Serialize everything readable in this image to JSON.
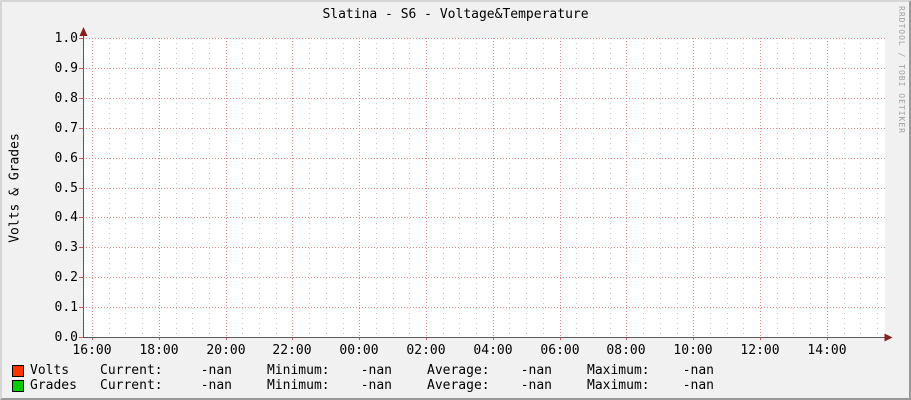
{
  "watermark": "RRDTOOL / TOBI OETIKER",
  "chart_data": {
    "type": "line",
    "title": "Slatina - S6 - Voltage&Temperature",
    "xlabel": "",
    "ylabel": "Volts & Grades",
    "ylim": [
      0.0,
      1.0
    ],
    "y_tick_step": 0.1,
    "y_ticks": [
      "0.0",
      "0.1",
      "0.2",
      "0.3",
      "0.4",
      "0.5",
      "0.6",
      "0.7",
      "0.8",
      "0.9",
      "1.0"
    ],
    "x_ticks": [
      "16:00",
      "18:00",
      "20:00",
      "22:00",
      "00:00",
      "02:00",
      "04:00",
      "06:00",
      "08:00",
      "10:00",
      "12:00",
      "14:00"
    ],
    "x_minor_divisions": 4,
    "grid": true,
    "legend_position": "bottom",
    "series": [
      {
        "name": "Volts",
        "color": "#ff3300",
        "values": []
      },
      {
        "name": "Grades",
        "color": "#00cc00",
        "values": []
      }
    ],
    "no_data": true
  },
  "legend": {
    "rows": [
      {
        "name": "Volts",
        "color": "#ff3300",
        "stats": [
          {
            "label": "Current:",
            "value": "-nan"
          },
          {
            "label": "Minimum:",
            "value": "-nan"
          },
          {
            "label": "Average:",
            "value": "-nan"
          },
          {
            "label": "Maximum:",
            "value": "-nan"
          }
        ]
      },
      {
        "name": "Grades",
        "color": "#00cc00",
        "stats": [
          {
            "label": "Current:",
            "value": "-nan"
          },
          {
            "label": "Minimum:",
            "value": "-nan"
          },
          {
            "label": "Average:",
            "value": "-nan"
          },
          {
            "label": "Maximum:",
            "value": "-nan"
          }
        ]
      }
    ]
  },
  "colors": {
    "background": "#f1f1f1",
    "canvas": "#ffffff",
    "grid_major": "#e88a8a",
    "grid_minor": "#c9c9c9",
    "tick_major": "#d05a5a",
    "tick_minor": "#b5b5b5",
    "axis": "#5a5a5a",
    "arrow": "#8b1e1e",
    "text": "#000000",
    "watermark_text": "#a0a0a0"
  }
}
